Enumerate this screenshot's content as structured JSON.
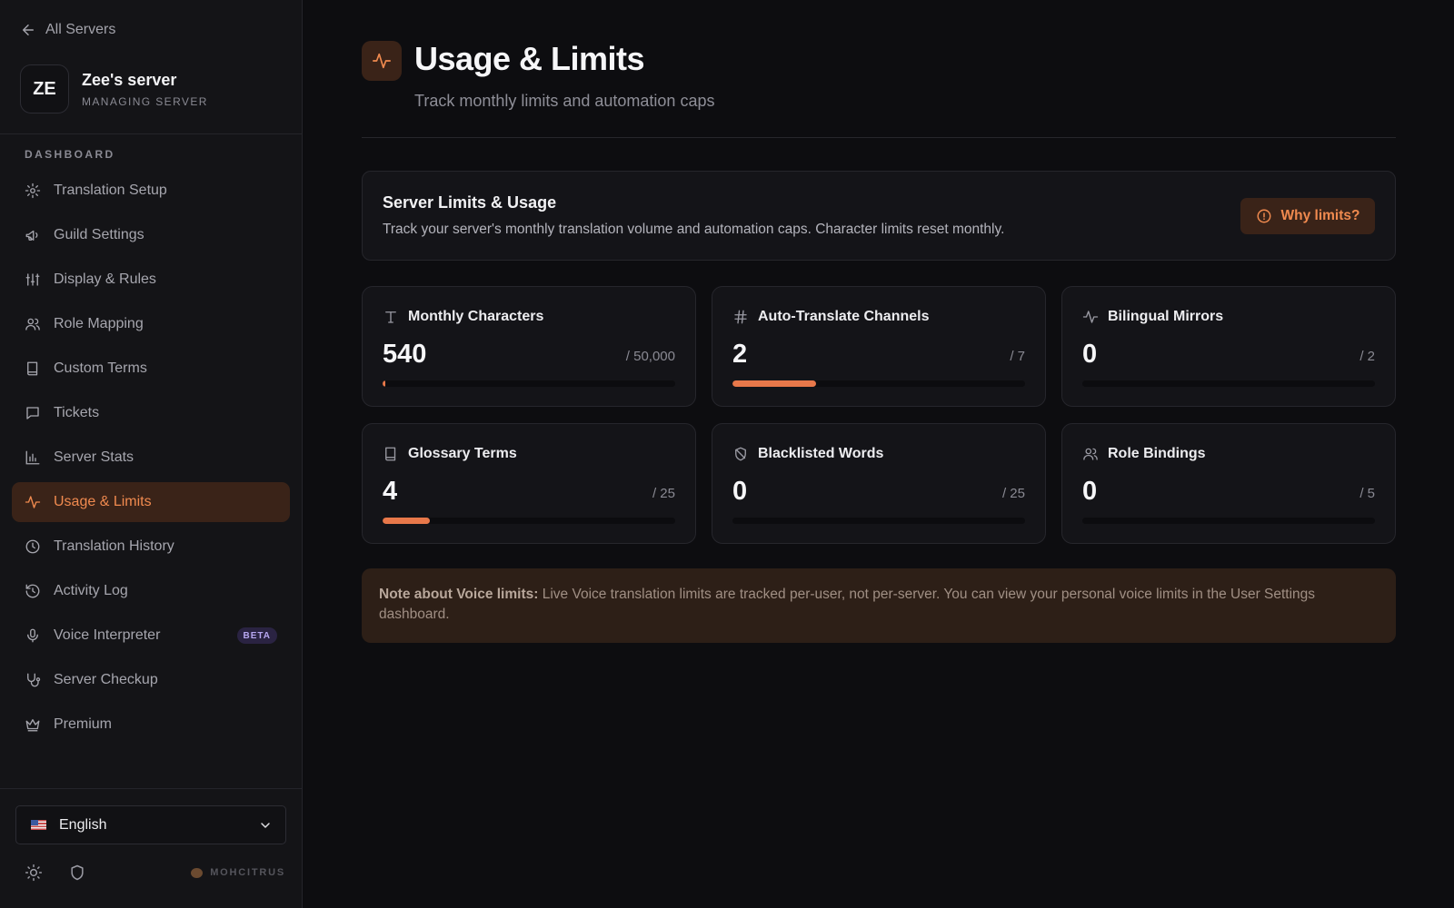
{
  "sidebar": {
    "back_label": "All Servers",
    "server": {
      "avatar": "ZE",
      "name": "Zee's server",
      "subtitle": "MANAGING SERVER"
    },
    "section_label": "DASHBOARD",
    "items": [
      {
        "label": "Translation Setup",
        "icon": "gear-icon"
      },
      {
        "label": "Guild Settings",
        "icon": "megaphone-icon"
      },
      {
        "label": "Display & Rules",
        "icon": "sliders-icon"
      },
      {
        "label": "Role Mapping",
        "icon": "users-icon"
      },
      {
        "label": "Custom Terms",
        "icon": "book-icon"
      },
      {
        "label": "Tickets",
        "icon": "message-icon"
      },
      {
        "label": "Server Stats",
        "icon": "bar-chart-icon"
      },
      {
        "label": "Usage & Limits",
        "icon": "activity-icon",
        "active": true
      },
      {
        "label": "Translation History",
        "icon": "clock-icon"
      },
      {
        "label": "Activity Log",
        "icon": "history-icon"
      },
      {
        "label": "Voice Interpreter",
        "icon": "mic-icon",
        "badge": "BETA"
      },
      {
        "label": "Server Checkup",
        "icon": "stethoscope-icon"
      },
      {
        "label": "Premium",
        "icon": "crown-icon"
      }
    ],
    "language": {
      "flag": "us-flag-icon",
      "label": "English"
    },
    "brand": "MOHCITRUS"
  },
  "header": {
    "title": "Usage & Limits",
    "subtitle": "Track monthly limits and automation caps"
  },
  "info_card": {
    "title": "Server Limits & Usage",
    "description": "Track your server's monthly translation volume and automation caps. Character limits reset monthly.",
    "button_label": "Why limits?"
  },
  "stats": [
    {
      "label": "Monthly Characters",
      "icon": "text-icon",
      "value": "540",
      "limit": "/ 50,000",
      "fraction": 0.0108
    },
    {
      "label": "Auto-Translate Channels",
      "icon": "hash-icon",
      "value": "2",
      "limit": "/ 7",
      "fraction": 0.2857
    },
    {
      "label": "Bilingual Mirrors",
      "icon": "activity-icon",
      "value": "0",
      "limit": "/ 2",
      "fraction": 0
    },
    {
      "label": "Glossary Terms",
      "icon": "book-icon",
      "value": "4",
      "limit": "/ 25",
      "fraction": 0.16
    },
    {
      "label": "Blacklisted Words",
      "icon": "shield-off-icon",
      "value": "0",
      "limit": "/ 25",
      "fraction": 0
    },
    {
      "label": "Role Bindings",
      "icon": "users-icon",
      "value": "0",
      "limit": "/ 5",
      "fraction": 0
    }
  ],
  "note": {
    "title": "Note about Voice limits:",
    "body": "Live Voice translation limits are tracked per-user, not per-server. You can view your personal voice limits in the User Settings dashboard."
  },
  "colors": {
    "accent": "#e8784a",
    "accent_bg": "#3a2318",
    "background": "#0d0d10",
    "card": "#141418"
  }
}
